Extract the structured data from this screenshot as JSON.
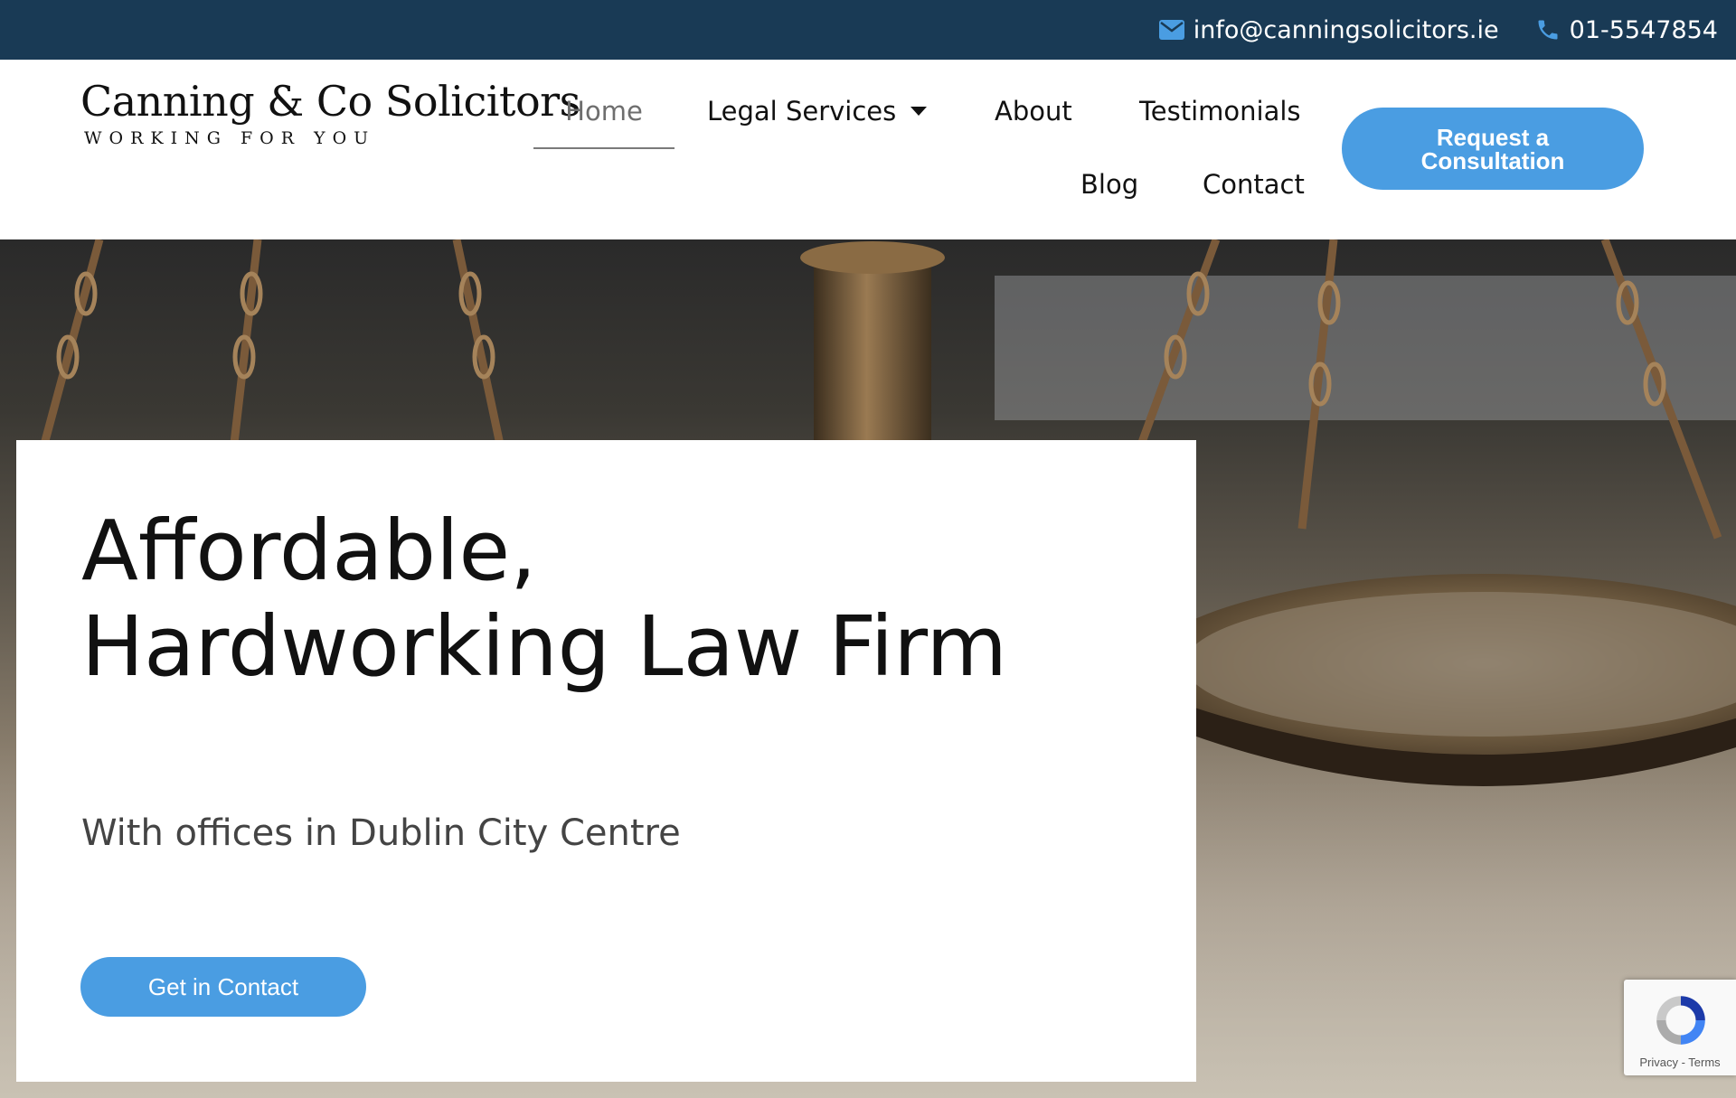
{
  "colors": {
    "topbar_bg": "#193a55",
    "accent": "#4a9de2",
    "nav_active": "#6e6e6e"
  },
  "topbar": {
    "email": {
      "icon": "envelope-icon",
      "text": "info@canningsolicitors.ie"
    },
    "phone": {
      "icon": "phone-icon",
      "text": "01-5547854"
    }
  },
  "header": {
    "logo": {
      "name": "Canning & Co Solicitors",
      "tagline": "WORKING FOR YOU"
    },
    "nav": {
      "home": "Home",
      "legal_services": "Legal Services",
      "about": "About",
      "testimonials": "Testimonials",
      "blog": "Blog",
      "contact": "Contact"
    },
    "active_item": "Home",
    "cta_label": "Request a Consultation"
  },
  "hero": {
    "title": "Affordable, Hardworking Law Firm",
    "subtitle": "With offices in Dublin City Centre",
    "cta_label": "Get in Contact",
    "background_image": "scales of justice"
  },
  "recaptcha": {
    "icon": "recaptcha-icon",
    "privacy": "Privacy",
    "separator": " - ",
    "terms": "Terms"
  }
}
